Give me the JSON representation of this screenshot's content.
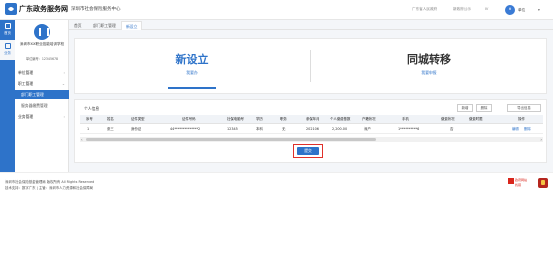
{
  "header": {
    "brand": "广东政务服务网",
    "system_name": "深圳市社会保险服务中心",
    "links": [
      "广东省人民政府",
      "新政府公示",
      "Ⅳ"
    ],
    "username": "单位",
    "caret": "▾"
  },
  "leftbar": {
    "items": [
      {
        "label": "首页",
        "icon": "home-icon"
      },
      {
        "label": "业务",
        "icon": "list-icon"
      }
    ]
  },
  "sidebar": {
    "org_name": "深圳市XX职业技能培训学校",
    "org_id": "单位编号：12345678",
    "menu": [
      {
        "label": "单位管理",
        "arrow": "›"
      },
      {
        "label": "职工管理",
        "arrow": "⌄"
      },
      {
        "label": "部门职工管理",
        "active": true
      },
      {
        "label": "服务器缴费管理"
      },
      {
        "label": "业务管理",
        "arrow": "›"
      }
    ]
  },
  "tabs": [
    "首页",
    "部门职工管理",
    "新设立"
  ],
  "options": {
    "new": {
      "title": "新设立",
      "subtitle": "我要办"
    },
    "transfer": {
      "title": "同城转移",
      "subtitle": "我要申报"
    }
  },
  "table": {
    "section_title": "个人信息",
    "buttons": [
      "新增",
      "删除",
      "导出信息"
    ],
    "columns": [
      "序号",
      "姓名",
      "证件类型",
      "证件号码",
      "社保电脑号",
      "学历",
      "职务",
      "参保年月",
      "个人缴费基数",
      "户籍状况",
      "手机",
      "缴费状况",
      "缴费时限",
      "操作"
    ],
    "rows": [
      {
        "no": "1",
        "name": "张三",
        "id_type": "身份证",
        "id_number": "44**************2",
        "si_number": "12345",
        "education": "本科",
        "position": "无",
        "month": "202106",
        "base": "2,200.00",
        "household": "深户",
        "phone": "1**********6",
        "pay_status": "否",
        "pay_limit": "",
        "actions": [
          "编辑",
          "删除"
        ]
      }
    ]
  },
  "submit_label": "提交",
  "footer": {
    "line1": "深圳市社会保险基金管理局 版权所有 All Rights Reserved",
    "line2": "技术支持：数字广东 | 主管：深圳市人力资源和社会保障局"
  },
  "badges": {
    "gov": {
      "line1": "政府网站",
      "line2": "找错"
    }
  },
  "colors": {
    "primary": "#2e73c9",
    "highlight": "#e0312b"
  }
}
